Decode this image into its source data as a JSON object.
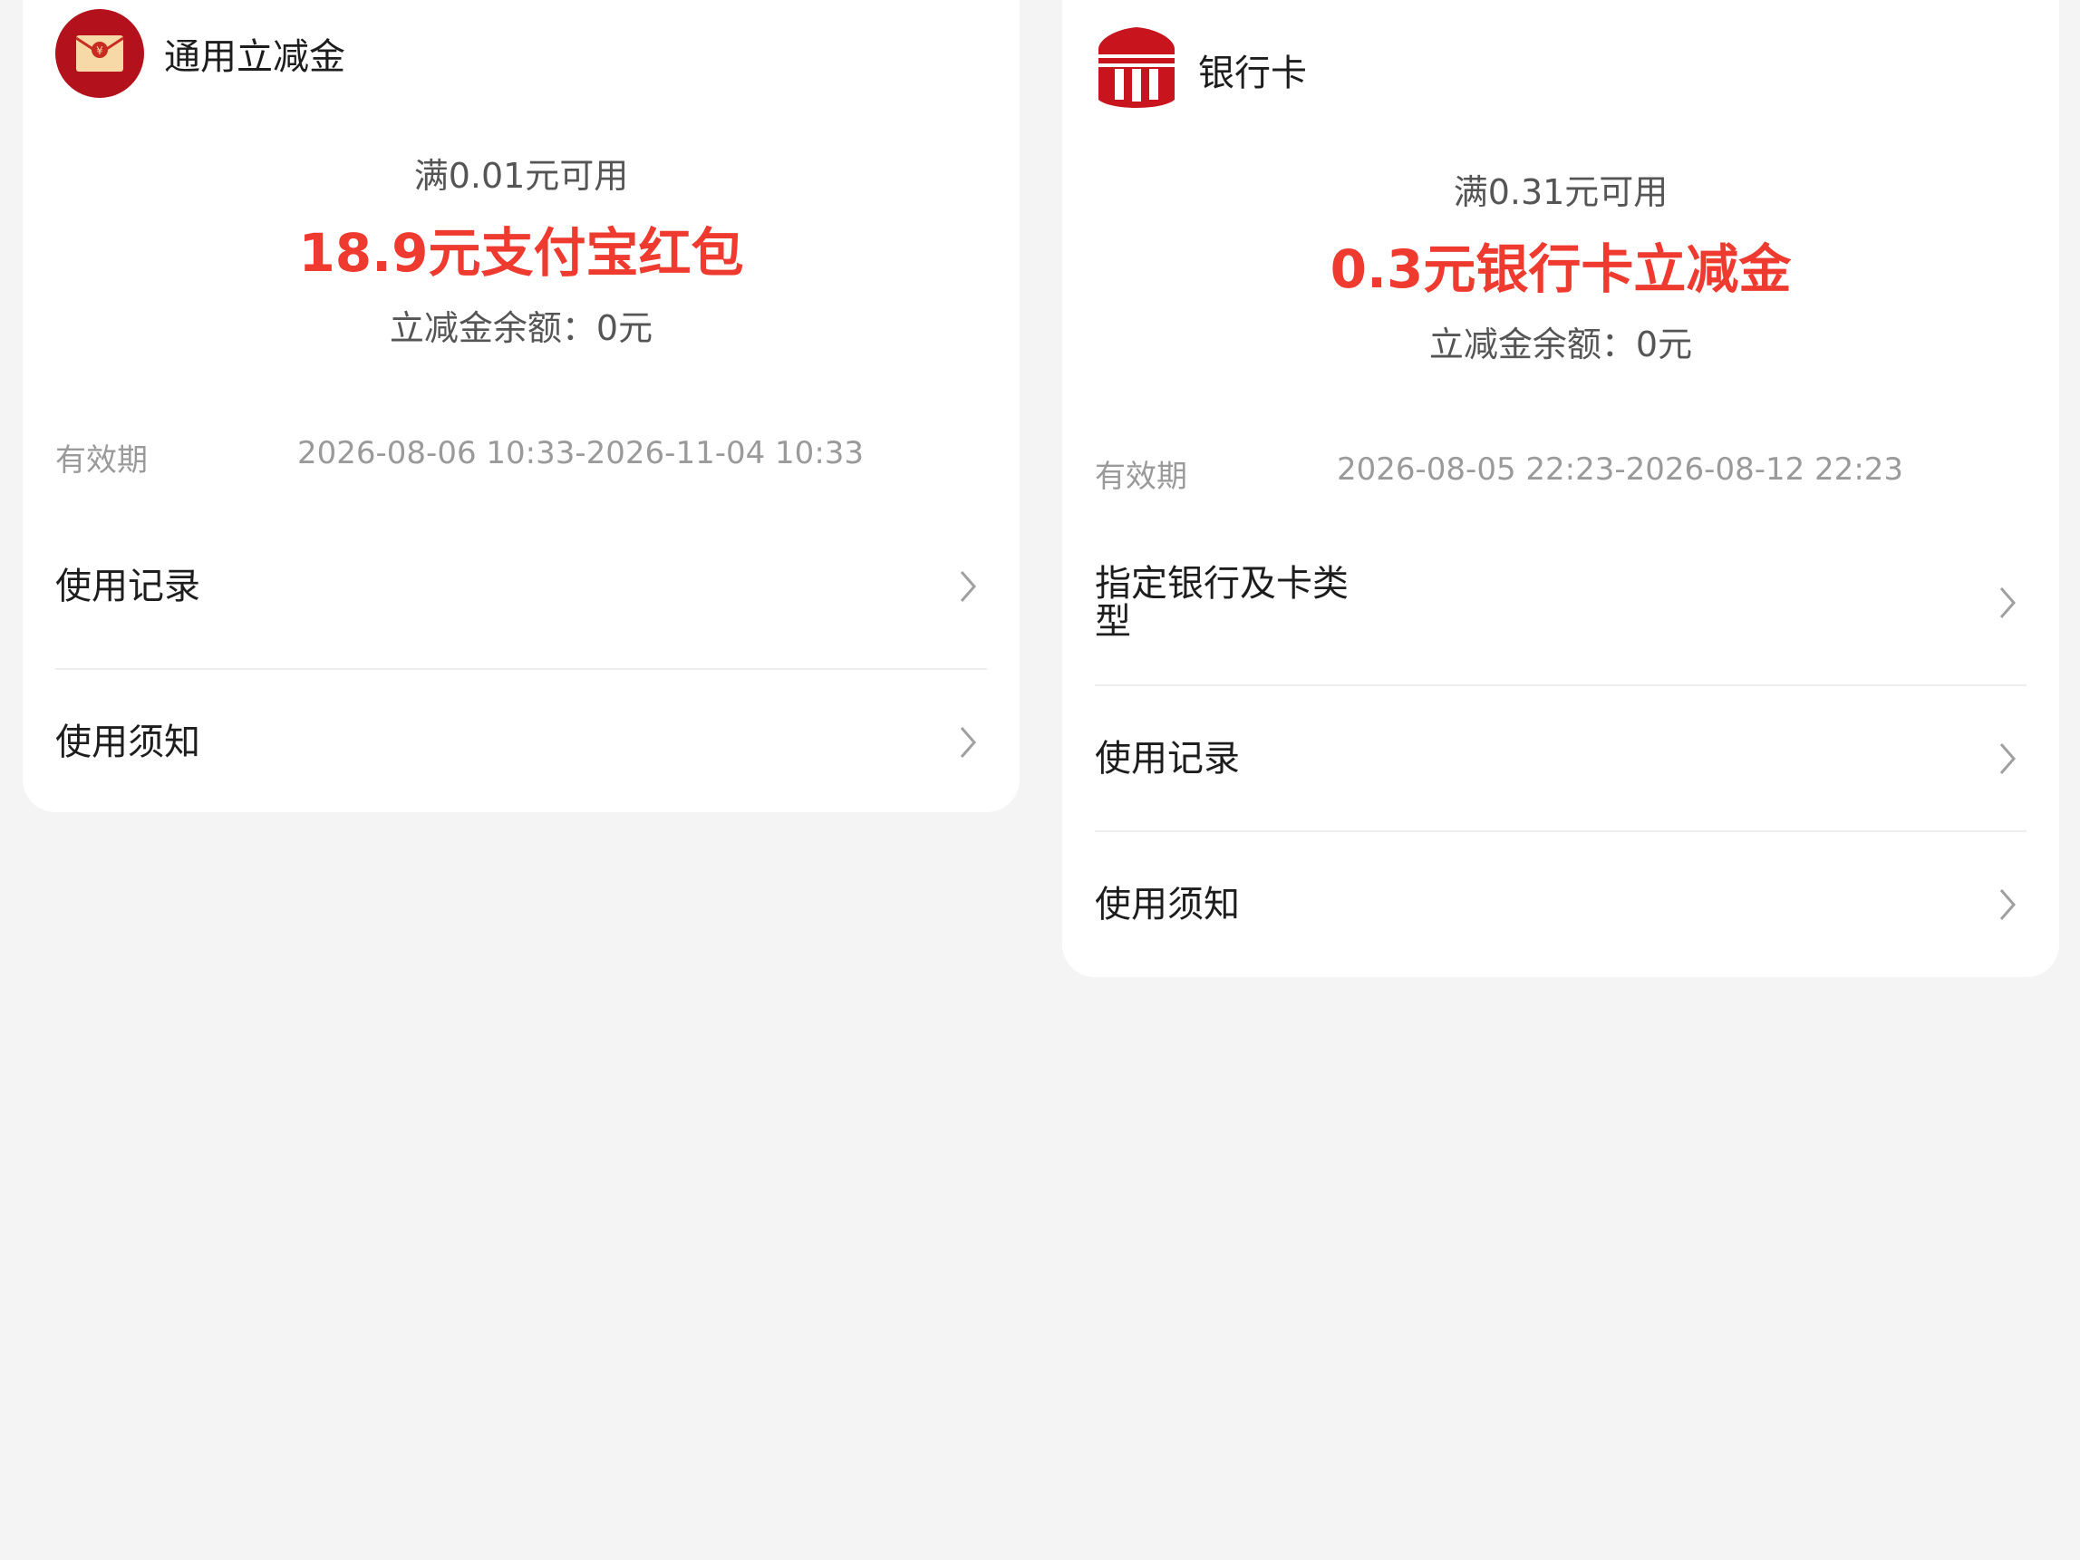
{
  "cards": [
    {
      "title": "通用立减金",
      "icon": "red-envelope-icon",
      "condition": "满0.01元可用",
      "amount": "18.9元支付宝红包",
      "balance": "立减金余额：0元",
      "validity_label": "有效期",
      "validity_value": "2026-08-06 10:33-2026-11-04 10:33",
      "rows": [
        "使用记录",
        "使用须知"
      ]
    },
    {
      "title": "银行卡",
      "icon": "bank-icon",
      "condition": "满0.31元可用",
      "amount": "0.3元银行卡立减金",
      "balance": "立减金余额：0元",
      "validity_label": "有效期",
      "validity_value": "2026-08-05 22:23-2026-08-12 22:23",
      "rows": [
        "指定银行及卡类型",
        "使用记录",
        "使用须知"
      ]
    }
  ],
  "colors": {
    "accent_red": "#ee3a2f",
    "brand_dark_red": "#b3121c",
    "background": "#f4f4f4"
  }
}
